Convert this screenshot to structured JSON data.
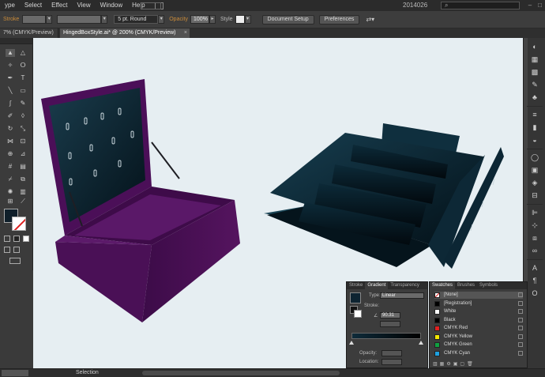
{
  "menubar": {
    "items": [
      "ype",
      "Select",
      "Effect",
      "View",
      "Window",
      "Help"
    ],
    "workspace_label": "2014026"
  },
  "controlbar": {
    "stroke_label": "Stroke",
    "stroke_style": "5 pt. Round",
    "opacity_label": "Opacity",
    "opacity_value": "100%",
    "style_label": "Style",
    "document_setup": "Document Setup",
    "preferences": "Preferences"
  },
  "tabs": {
    "inactive": "7% (CMYK/Preview)",
    "active": "HingedBoxStyle.ai* @ 200% (CMYK/Preview)"
  },
  "gradient_panel": {
    "tabs": [
      "Stroke",
      "Gradient",
      "Transparency"
    ],
    "type_label": "Type:",
    "type_value": "Linear",
    "stroke_label": "Stroke:",
    "angle_value": "90.31",
    "opacity_label": "Opacity:",
    "location_label": "Location:"
  },
  "swatches_panel": {
    "tabs": [
      "Swatches",
      "Brushes",
      "Symbols"
    ],
    "items": [
      {
        "name": "[None]",
        "color": "#ffffff"
      },
      {
        "name": "[Registration]",
        "color": "#000000"
      },
      {
        "name": "White",
        "color": "#ffffff"
      },
      {
        "name": "Black",
        "color": "#000000"
      },
      {
        "name": "CMYK Red",
        "color": "#e02020"
      },
      {
        "name": "CMYK Yellow",
        "color": "#f2e600"
      },
      {
        "name": "CMYK Green",
        "color": "#10a040"
      },
      {
        "name": "CMYK Cyan",
        "color": "#1ea0e0"
      }
    ]
  },
  "statusbar": {
    "tool": "Selection"
  },
  "colors": {
    "box_purple": "#4d0f5a",
    "box_purple_dark": "#37083f",
    "tray_teal": "#0e2f3f",
    "tray_dark": "#04121a",
    "canvas_bg": "#e6eef2"
  },
  "icons": {
    "tools": [
      "selection-icon",
      "direct-selection-icon",
      "magic-wand-icon",
      "lasso-icon",
      "pen-icon",
      "type-icon",
      "line-icon",
      "rectangle-icon",
      "paintbrush-icon",
      "pencil-icon",
      "blob-brush-icon",
      "eraser-icon",
      "rotate-icon",
      "scale-icon",
      "width-icon",
      "free-transform-icon",
      "shape-builder-icon",
      "perspective-icon",
      "mesh-icon",
      "gradient-icon",
      "eyedropper-icon",
      "blend-icon",
      "symbol-sprayer-icon",
      "graph-icon",
      "artboard-icon",
      "slice-icon",
      "hand-icon",
      "zoom-icon"
    ],
    "dock": [
      "color-icon",
      "color-guide-icon",
      "swatches-icon",
      "brushes-icon",
      "symbols-icon",
      "stroke-icon",
      "gradient-icon",
      "transparency-icon",
      "appearance-icon",
      "graphic-styles-icon",
      "layers-icon",
      "artboards-icon",
      "align-icon",
      "transform-icon",
      "pathfinder-icon",
      "links-icon",
      "character-icon",
      "paragraph-icon",
      "opentype-icon"
    ]
  }
}
